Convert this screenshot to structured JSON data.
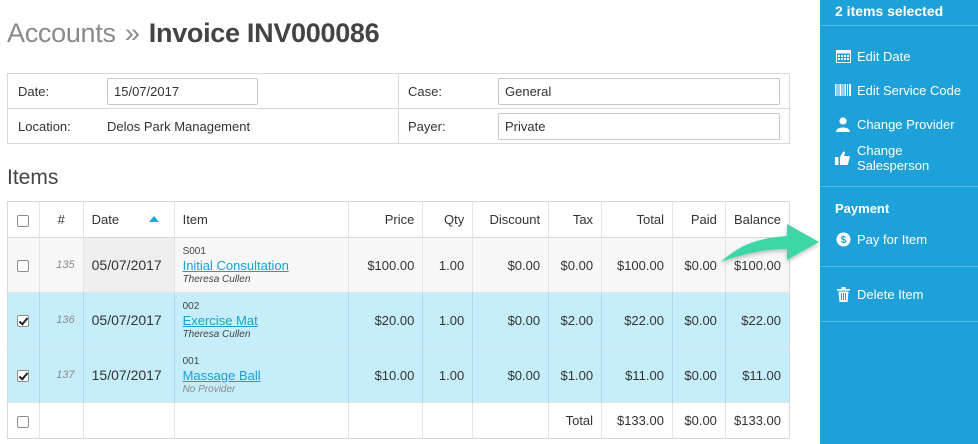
{
  "header": {
    "breadcrumb": "Accounts",
    "separator": "»",
    "page_title": "Invoice INV000086"
  },
  "info": {
    "date_label": "Date:",
    "date_value": "15/07/2017",
    "case_label": "Case:",
    "case_value": "General",
    "location_label": "Location:",
    "location_value": "Delos Park Management",
    "payer_label": "Payer:",
    "payer_value": "Private"
  },
  "items_section": {
    "title": "Items",
    "columns": [
      "#",
      "Date",
      "Item",
      "Price",
      "Qty",
      "Discount",
      "Tax",
      "Total",
      "Paid",
      "Balance"
    ],
    "rows": [
      {
        "checked": false,
        "num": "135",
        "date": "05/07/2017",
        "code": "S001",
        "name": "Initial Consultation",
        "provider": "Theresa Cullen",
        "price": "$100.00",
        "qty": "1.00",
        "discount": "$0.00",
        "tax": "$0.00",
        "total": "$100.00",
        "paid": "$0.00",
        "balance": "$100.00"
      },
      {
        "checked": true,
        "num": "136",
        "date": "05/07/2017",
        "code": "002",
        "name": "Exercise Mat",
        "provider": "Theresa Cullen",
        "price": "$20.00",
        "qty": "1.00",
        "discount": "$0.00",
        "tax": "$2.00",
        "total": "$22.00",
        "paid": "$0.00",
        "balance": "$22.00"
      },
      {
        "checked": true,
        "num": "137",
        "date": "15/07/2017",
        "code": "001",
        "name": "Massage Ball",
        "provider": "No Provider",
        "price": "$10.00",
        "qty": "1.00",
        "discount": "$0.00",
        "tax": "$1.00",
        "total": "$11.00",
        "paid": "$0.00",
        "balance": "$11.00"
      }
    ],
    "totals": {
      "label": "Total",
      "total": "$133.00",
      "paid": "$0.00",
      "balance": "$133.00"
    }
  },
  "sidebar": {
    "selection_label": "2 items selected",
    "actions": [
      {
        "label": "Edit Date",
        "icon": "calendar-icon"
      },
      {
        "label": "Edit Service Code",
        "icon": "barcode-icon"
      },
      {
        "label": "Change Provider",
        "icon": "user-icon"
      },
      {
        "label": "Change Salesperson",
        "icon": "thumbs-up-icon"
      }
    ],
    "payment_group_label": "Payment",
    "pay_label": "Pay for Item",
    "delete_label": "Delete Item"
  },
  "colors": {
    "sidebar_bg": "#1ea0d8",
    "selected_row": "#c6eefa",
    "link": "#1a9fd0",
    "negative": "#e02b2b",
    "callout_arrow": "#3cd6a6"
  }
}
